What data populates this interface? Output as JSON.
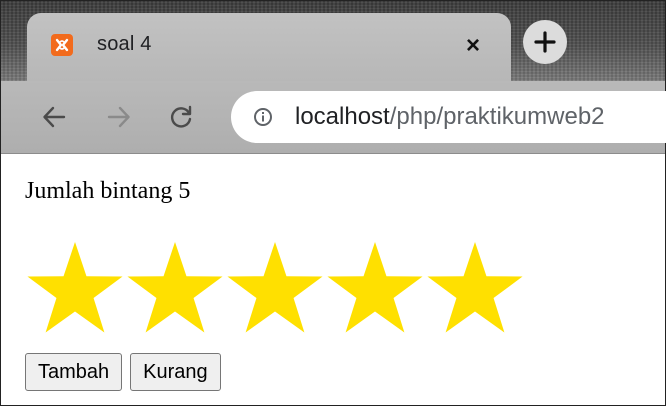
{
  "browser": {
    "tab": {
      "title": "soal 4",
      "favicon": "xampp-icon",
      "close_glyph": "×"
    },
    "new_tab_glyph": "+",
    "nav": {
      "back_icon": "arrow-left-icon",
      "forward_icon": "arrow-right-icon",
      "reload_icon": "reload-icon"
    },
    "url": {
      "host": "localhost",
      "path": "/php/praktikumweb2"
    }
  },
  "page": {
    "heading": "Jumlah bintang 5",
    "star_count": 5,
    "star_color": "#ffe000",
    "buttons": {
      "add_label": "Tambah",
      "subtract_label": "Kurang"
    }
  }
}
